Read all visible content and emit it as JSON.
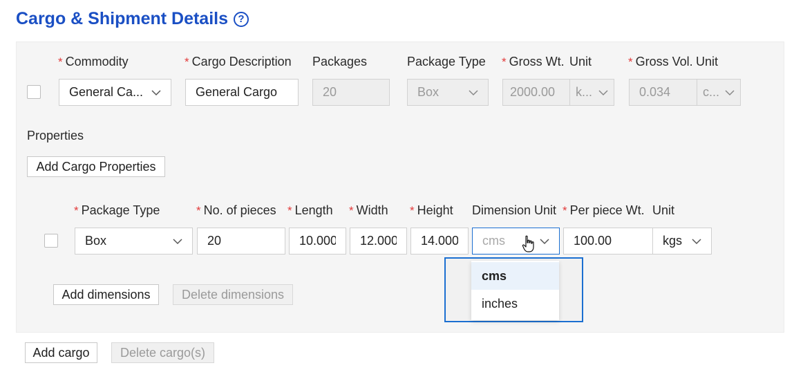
{
  "header": {
    "title": "Cargo & Shipment Details",
    "help_glyph": "?"
  },
  "cargo": {
    "labels": {
      "commodity": "Commodity",
      "description": "Cargo Description",
      "packages": "Packages",
      "package_type": "Package Type",
      "gross_wt": "Gross Wt.",
      "unit1": "Unit",
      "gross_vol": "Gross Vol.",
      "unit2": "Unit"
    },
    "values": {
      "commodity": "General Ca...",
      "description": "General Cargo",
      "packages": "20",
      "package_type": "Box",
      "gross_wt": "2000.00",
      "gross_wt_unit": "k...",
      "gross_vol": "0.034",
      "gross_vol_unit": "c..."
    },
    "properties_label": "Properties",
    "add_properties": "Add Cargo Properties"
  },
  "dimensions": {
    "labels": {
      "package_type": "Package Type",
      "pieces": "No. of pieces",
      "length": "Length",
      "width": "Width",
      "height": "Height",
      "dim_unit": "Dimension Unit",
      "per_piece_wt": "Per piece Wt.",
      "unit": "Unit"
    },
    "values": {
      "package_type": "Box",
      "pieces": "20",
      "length": "10.000",
      "width": "12.000",
      "height": "14.000",
      "dim_unit_placeholder": "cms",
      "per_piece_wt": "100.00",
      "unit": "kgs"
    },
    "dropdown_options": [
      "cms",
      "inches"
    ],
    "add_dimensions": "Add dimensions",
    "delete_dimensions": "Delete dimensions"
  },
  "footer": {
    "add_cargo": "Add cargo",
    "delete_cargo": "Delete cargo(s)"
  },
  "colors": {
    "accent": "#1a4fc4",
    "focus": "#1b6fd1",
    "required": "#e23b3b"
  }
}
